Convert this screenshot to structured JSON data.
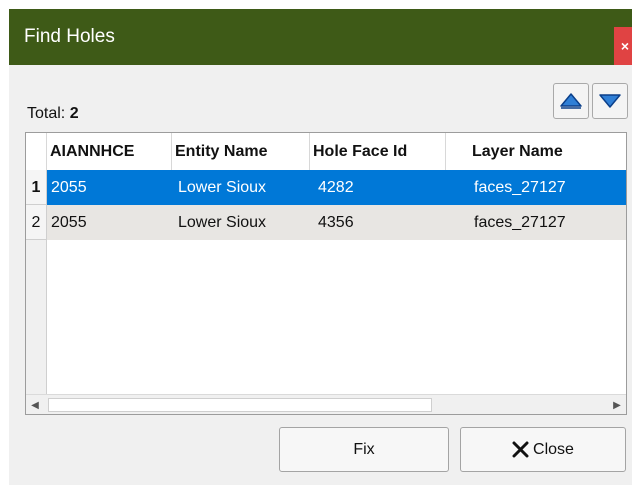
{
  "window": {
    "title": "Find Holes",
    "close_glyph": "×"
  },
  "summary": {
    "total_label": "Total:",
    "total_value": "2"
  },
  "sort_buttons": {
    "up_icon": "triangle-up-icon",
    "down_icon": "triangle-down-icon"
  },
  "table": {
    "columns": [
      "AIANNHCE",
      "Entity Name",
      "Hole Face Id",
      "Layer Name"
    ],
    "rows": [
      {
        "num": "1",
        "cells": [
          "2055",
          "Lower Sioux",
          "4282",
          "faces_27127"
        ],
        "selected": true
      },
      {
        "num": "2",
        "cells": [
          "2055",
          "Lower Sioux",
          "4356",
          "faces_27127"
        ],
        "selected": false
      }
    ]
  },
  "buttons": {
    "fix_label": "Fix",
    "close_label": "Close",
    "close_icon": "x-icon"
  },
  "colors": {
    "titlebar": "#3e5a17",
    "selection": "#0078d7",
    "close_button": "#e04343",
    "sort_icon_fill": "#2f7fd6"
  }
}
